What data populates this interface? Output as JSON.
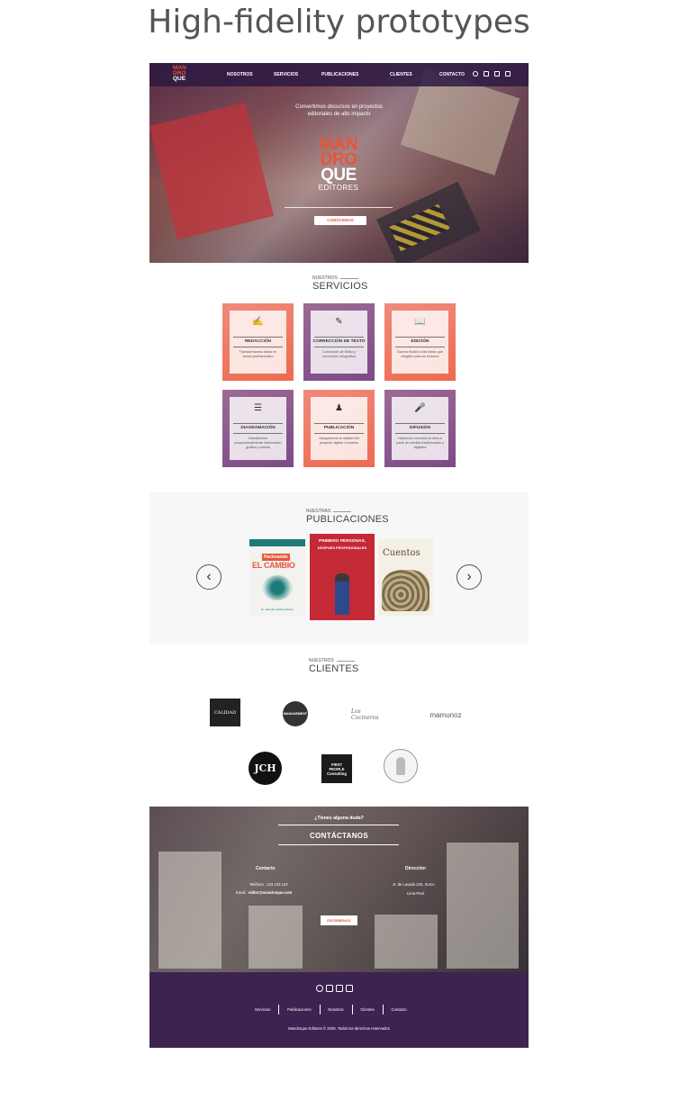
{
  "page_title": "High-fidelity prototypes",
  "brand": {
    "logo_lines": [
      "MAN",
      "DRO",
      "QUE"
    ],
    "logo_sub": "EDITORES",
    "accent": "#e8553a",
    "purple": "#3c2350"
  },
  "nav": {
    "items": [
      "NOSOTROS",
      "SERVICIOS",
      "PUBLICACIONES",
      "CLIENTES",
      "CONTACTO"
    ],
    "icons": [
      "whatsapp-icon",
      "facebook-icon",
      "instagram-icon",
      "linkedin-icon"
    ]
  },
  "hero": {
    "tagline_1": "Convertimos discursos en proyectos",
    "tagline_2": "editoriales de alto impacto",
    "cta": "CONÓCENOS"
  },
  "services": {
    "kicker": "NUESTROS",
    "title": "SERVICIOS",
    "items": [
      {
        "name": "REDACCIÓN",
        "desc": "Transformamos ideas en textos profesionales",
        "icon": "pen-hand-icon",
        "color": "orange"
      },
      {
        "name": "CORRECCIÓN DE TEXTO",
        "desc": "Corrección de Estilo y corrección ortográfica",
        "icon": "edit-document-icon",
        "color": "purple"
      },
      {
        "name": "EDICIÓN",
        "desc": "Damos fluidez a las ideas que elegiste para los lectores",
        "icon": "open-book-icon",
        "color": "orange"
      },
      {
        "name": "DIAGRAMACIÓN",
        "desc": "Distribuimos proporcionalmente información gráfica y escrita",
        "icon": "layers-icon",
        "color": "purple"
      },
      {
        "name": "PUBLICACIÓN",
        "desc": "Aseguramos la calidad del proyecto digital o impreso",
        "icon": "books-person-icon",
        "color": "orange"
      },
      {
        "name": "DIFUSIÓN",
        "desc": "Hacemos conocida tu obra a partir de medios tradicionales y digitales",
        "icon": "microphone-icon",
        "color": "purple"
      }
    ]
  },
  "publications": {
    "kicker": "NUESTRAS",
    "title": "PUBLICACIONES",
    "books": [
      {
        "title_top": "Hackeando",
        "title_big": "EL CAMBIO",
        "author": "Dr. Hamilton Muñoz Rocca"
      },
      {
        "title_top": "PRIMERO PERSONAS,",
        "title_big": "DESPUÉS PROFESIONALES",
        "author": ""
      },
      {
        "title_top": "Cuentos",
        "title_big": "",
        "author": ""
      }
    ]
  },
  "clients": {
    "kicker": "NUESTROS",
    "title": "CLIENTES",
    "row1": [
      "CALIDAD",
      "MANAGEMENT",
      "Los Cocineros",
      "mamunoz"
    ],
    "row2": [
      "JCH",
      "FIRST PEOPLE Consulting",
      ""
    ]
  },
  "contact": {
    "question": "¿Tienes alguna duda?",
    "title": "CONTÁCTANOS",
    "col1_head": "Contacto",
    "phone": "Teléfono : 123 123 123",
    "email_label": "Email : ",
    "email": "editor@mandroque.com",
    "col2_head": "Dirección",
    "address_1": "Jr. de Lavado 225, Surco",
    "address_2": "Lima-Perú",
    "cta": "ESCRÍBENOS"
  },
  "footer": {
    "links": [
      "Servicios",
      "Publicaciones",
      "Nosotros",
      "Clientes",
      "Contacto"
    ],
    "copyright": "Mandroque Editores © 2020. Todos los derechos reservados"
  }
}
